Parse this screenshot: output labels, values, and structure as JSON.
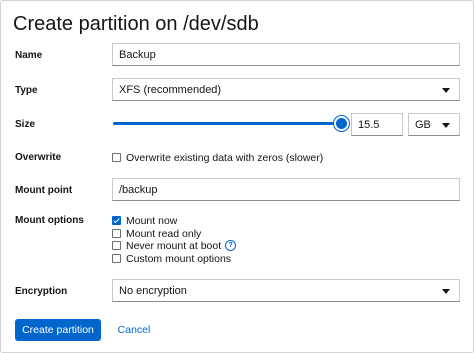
{
  "dialog": {
    "title": "Create partition on /dev/sdb"
  },
  "fields": {
    "name": {
      "label": "Name",
      "value": "Backup"
    },
    "type": {
      "label": "Type",
      "value": "XFS (recommended)"
    },
    "size": {
      "label": "Size",
      "value": "15.5",
      "unit": "GB",
      "slider_fraction": 1.0
    },
    "overwrite": {
      "label": "Overwrite",
      "option": "Overwrite existing data with zeros (slower)",
      "checked": false
    },
    "mount_point": {
      "label": "Mount point",
      "value": "/backup"
    },
    "mount_options": {
      "label": "Mount options",
      "items": [
        {
          "label": "Mount now",
          "checked": true
        },
        {
          "label": "Mount read only",
          "checked": false
        },
        {
          "label": "Never mount at boot",
          "checked": false
        },
        {
          "label": "Custom mount options",
          "checked": false
        }
      ]
    },
    "encryption": {
      "label": "Encryption",
      "value": "No encryption"
    }
  },
  "actions": {
    "create_label": "Create partition",
    "cancel_label": "Cancel"
  },
  "colors": {
    "accent": "#0066cc",
    "text": "#151515",
    "border": "#d2d2d2"
  },
  "icons": {
    "select_arrow": "caret-down-icon",
    "help": "help-icon"
  }
}
